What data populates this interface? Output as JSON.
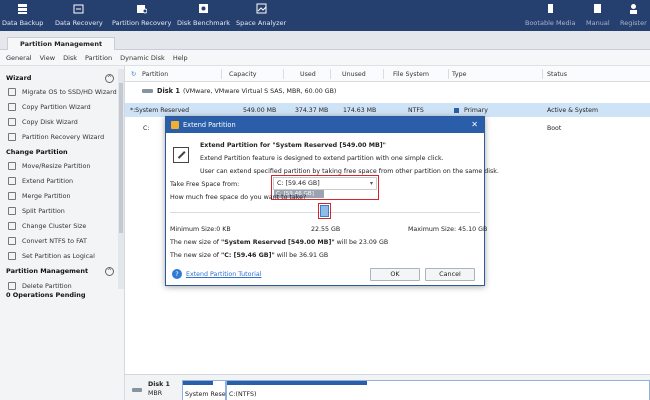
{
  "toolbar": {
    "items": [
      {
        "label": "Data Backup",
        "icon": "data-backup-icon"
      },
      {
        "label": "Data Recovery",
        "icon": "data-recovery-icon"
      },
      {
        "label": "Partition Recovery",
        "icon": "partition-recovery-icon"
      },
      {
        "label": "Disk Benchmark",
        "icon": "disk-benchmark-icon"
      },
      {
        "label": "Space Analyzer",
        "icon": "space-analyzer-icon"
      },
      {
        "label": "Bootable Media",
        "icon": "bootable-media-icon"
      },
      {
        "label": "Manual",
        "icon": "manual-icon"
      },
      {
        "label": "Register",
        "icon": "register-icon"
      }
    ]
  },
  "tabs": {
    "active": "Partition Management"
  },
  "menu": [
    "General",
    "View",
    "Disk",
    "Partition",
    "Dynamic Disk",
    "Help"
  ],
  "sidebar": {
    "wizard_title": "Wizard",
    "wizard_items": [
      "Migrate OS to SSD/HD Wizard",
      "Copy Partition Wizard",
      "Copy Disk Wizard",
      "Partition Recovery Wizard"
    ],
    "change_title": "Change Partition",
    "change_items": [
      "Move/Resize Partition",
      "Extend Partition",
      "Merge Partition",
      "Split Partition",
      "Change Cluster Size",
      "Convert NTFS to FAT",
      "Set Partition as Logical"
    ],
    "manage_title": "Partition Management",
    "manage_items": [
      "Delete Partition"
    ],
    "pending": "0 Operations Pending"
  },
  "grid": {
    "headers": [
      "Partition",
      "Capacity",
      "Used",
      "Unused",
      "File System",
      "Type",
      "Status"
    ],
    "disk_label": "Disk 1",
    "disk_desc": "(VMware, VMware Virtual S SAS, MBR, 60.00 GB)",
    "rows": [
      {
        "partition": "*:System Reserved",
        "capacity": "549.00 MB",
        "used": "374.37 MB",
        "unused": "174.63 MB",
        "fs": "NTFS",
        "type": "Primary",
        "status": "Active & System"
      },
      {
        "partition": "C:",
        "capacity": "",
        "used": "",
        "unused": "",
        "fs": "",
        "type": "",
        "status": "Boot"
      }
    ]
  },
  "disk_map": {
    "disk": "Disk 1",
    "scheme": "MBR",
    "seg1": "System Rese",
    "seg2": "C:(NTFS)"
  },
  "dialog": {
    "title": "Extend Partition",
    "heading": "Extend Partition for \"System Reserved [549.00 MB]\"",
    "desc1": "Extend Partition feature is designed to extend partition with one simple click.",
    "desc2": "User can extend specified partition by taking free space from other partition on the same disk.",
    "take_label": "Take Free Space from:",
    "take_value": "C: [59.46 GB]",
    "dropdown_option": "C: [59.46 GB]",
    "how_much": "How much free space do you want to take?",
    "min_label": "Minimum Size:0 KB",
    "mid_value": "22.55 GB",
    "max_label": "Maximum Size: 45.10 GB",
    "slider_fraction": 0.5,
    "new_size_pre": "The new size of ",
    "new_size_1_name": "\"System Reserved [549.00 MB]\"",
    "new_size_1_post": " will be 23.09 GB",
    "new_size_2_name": "\"C: [59.46 GB]\"",
    "new_size_2_post": " will be 36.91 GB",
    "tutorial": "Extend Partition Tutorial",
    "ok": "OK",
    "cancel": "Cancel"
  }
}
